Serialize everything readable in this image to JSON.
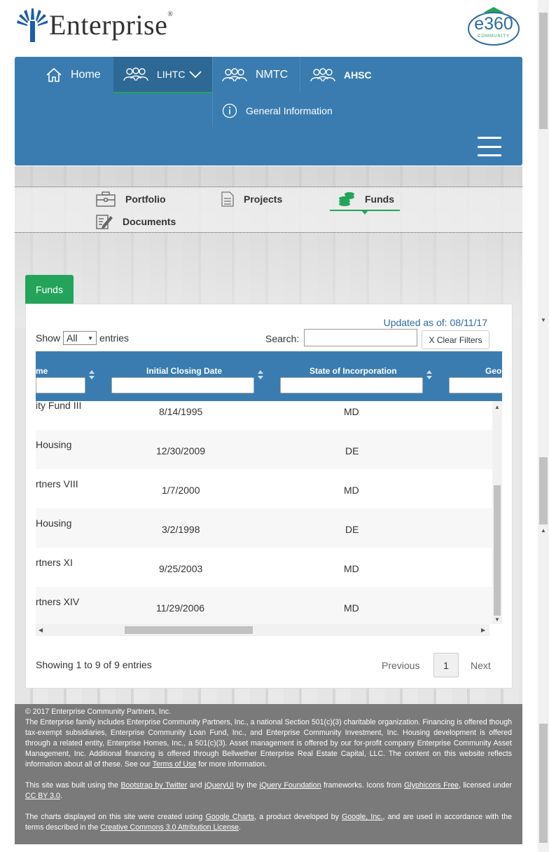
{
  "brand": {
    "name": "Enterprise",
    "badge": "e360",
    "badge_sub": "COMMUNITY",
    "accent": "#3a7cb0",
    "green": "#23a45a"
  },
  "nav": {
    "home": "Home",
    "lihtc": "LIHTC",
    "nmtc": "NMTC",
    "ahsc": "AHSC",
    "general_info": "General Information"
  },
  "subnav": {
    "portfolio": "Portfolio",
    "projects": "Projects",
    "funds": "Funds",
    "documents": "Documents"
  },
  "funds_tab": "Funds",
  "panel": {
    "updated": "Updated as of: 08/11/17",
    "show_label": "Show",
    "show_value": "All",
    "entries_label": "entries",
    "search_label": "Search:",
    "clear_filters": "X Clear Filters"
  },
  "table": {
    "headers": [
      "me",
      "Initial Closing Date",
      "State of Incorporation",
      "Geo"
    ],
    "rows": [
      {
        "name": "ity Fund III",
        "date": "8/14/1995",
        "state": "MD"
      },
      {
        "name": "Housing",
        "date": "12/30/2009",
        "state": "DE"
      },
      {
        "name": "rtners VIII",
        "date": "1/7/2000",
        "state": "MD"
      },
      {
        "name": "Housing",
        "date": "3/2/1998",
        "state": "DE"
      },
      {
        "name": "rtners XI",
        "date": "9/25/2003",
        "state": "MD"
      },
      {
        "name": "rtners XIV",
        "date": "11/29/2006",
        "state": "MD"
      }
    ]
  },
  "pagination": {
    "info": "Showing 1 to 9 of 9 entries",
    "previous": "Previous",
    "page": "1",
    "next": "Next"
  },
  "footer": {
    "copyright": "© 2017 Enterprise Community Partners, Inc.",
    "p1a": "The Enterprise family includes Enterprise Community Partners, Inc., a national Section 501(c)(3) charitable organization. Financing is offered though tax-exempt subsidiaries, Enterprise Community Loan Fund, Inc., and Enterprise Community Investment, Inc. Housing development is offered through a related entity, Enterprise Homes, Inc., a 501(c)(3). Asset management is offered by our for-profit company Enterprise Community Asset Management, Inc. Additional financing is offered through Bellwether Enterprise Real Estate Capital, LLC. The content on this website reflects information about all of these. See our ",
    "terms_link": "Terms of Use",
    "p1b": " for more information.",
    "p2a": "This site was built using the ",
    "bootstrap_link": "Bootstrap by Twitter",
    "p2b": " and ",
    "jqueryui_link": "jQueryUI",
    "p2c": " by the ",
    "jquery_link": "jQuery Foundation",
    "p2d": " frameworks. Icons from ",
    "glyph_link": "Glyphicons Free",
    "p2e": ", licensed under ",
    "cc_link": "CC BY 3.0",
    "p2f": ".",
    "p3a": "The charts displayed on this site were created using ",
    "gcharts_link": "Google Charts",
    "p3b": ", a product developed by ",
    "google_link": "Google, Inc.",
    "p3c": ", and are used in accordance with the terms described in the ",
    "cca_link": "Creative Commons 3.0 Attribution License",
    "p3d": "."
  }
}
